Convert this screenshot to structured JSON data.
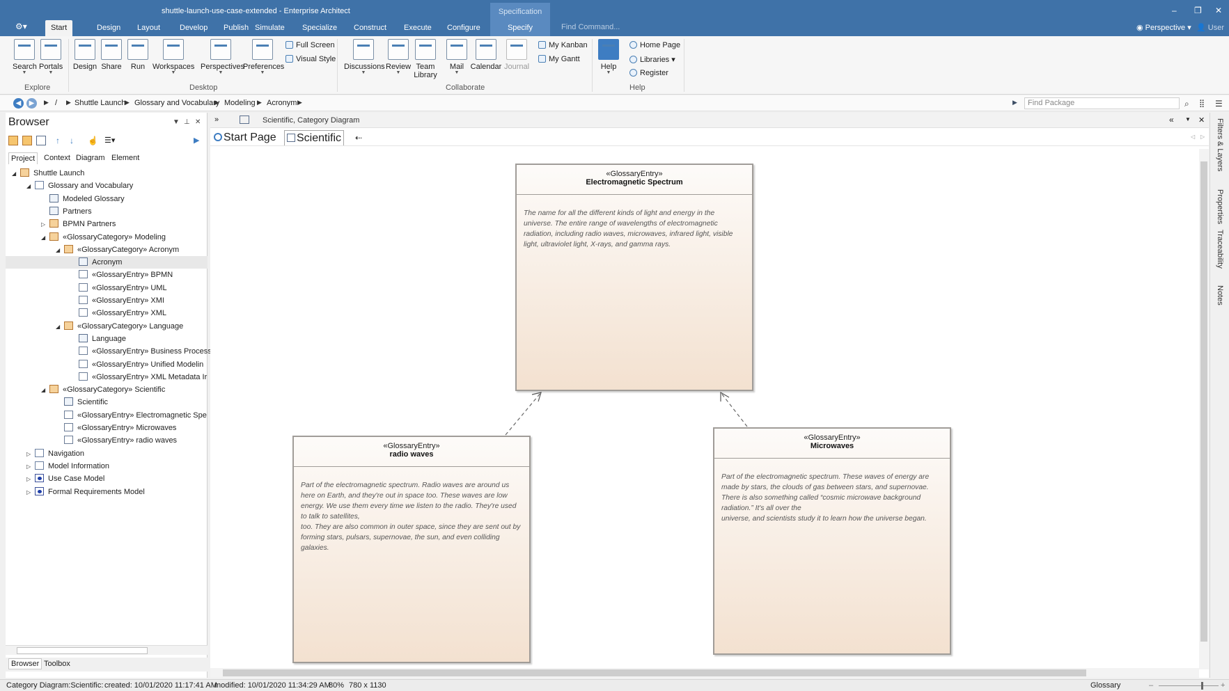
{
  "window": {
    "title": "shuttle-launch-use-case-extended - Enterprise Architect",
    "minimize": "–",
    "restore": "❐",
    "close": "✕"
  },
  "menu_tabs": [
    "Start",
    "Design",
    "Layout",
    "Develop",
    "Publish",
    "Simulate",
    "Specialize",
    "Construct",
    "Execute",
    "Configure"
  ],
  "spec_group": {
    "label": "Specification",
    "tab": "Specify"
  },
  "find_command": {
    "placeholder": "Find Command..."
  },
  "perspective": "Perspective",
  "user": "User",
  "ribbon": {
    "explore": {
      "label": "Explore",
      "search": "Search",
      "portals": "Portals"
    },
    "desktop": {
      "label": "Desktop",
      "design": "Design",
      "share": "Share",
      "run": "Run",
      "workspaces": "Workspaces",
      "perspectives": "Perspectives",
      "preferences": "Preferences",
      "full_screen": "Full Screen",
      "visual_style": "Visual Style"
    },
    "collaborate": {
      "label": "Collaborate",
      "discussions": "Discussions",
      "review": "Review",
      "team_library_1": "Team",
      "team_library_2": "Library",
      "mail": "Mail",
      "calendar": "Calendar",
      "journal": "Journal",
      "my_kanban": "My Kanban",
      "my_gantt": "My Gantt"
    },
    "help": {
      "label": "Help",
      "help": "Help",
      "home_page": "Home Page",
      "libraries": "Libraries",
      "register": "Register"
    }
  },
  "breadcrumb": [
    "/",
    "Shuttle Launch",
    "Glossary and Vocabulary",
    "Modeling",
    "Acronym"
  ],
  "find_package": {
    "placeholder": "Find Package"
  },
  "browser": {
    "title": "Browser",
    "tabs": [
      "Project",
      "Context",
      "Diagram",
      "Element"
    ],
    "tree": [
      {
        "label": "Shuttle Launch",
        "depth": 0,
        "icon": "model",
        "tw": "◢"
      },
      {
        "label": "Glossary and Vocabulary",
        "depth": 1,
        "icon": "package-model",
        "tw": "◢"
      },
      {
        "label": "Modeled Glossary",
        "depth": 2,
        "icon": "diagram",
        "tw": ""
      },
      {
        "label": "Partners",
        "depth": 2,
        "icon": "diagram",
        "tw": ""
      },
      {
        "label": "BPMN Partners",
        "depth": 2,
        "icon": "package",
        "tw": "▷"
      },
      {
        "label": "«GlossaryCategory» Modeling",
        "depth": 2,
        "icon": "package",
        "tw": "◢"
      },
      {
        "label": "«GlossaryCategory» Acronym",
        "depth": 3,
        "icon": "package",
        "tw": "◢"
      },
      {
        "label": "Acronym",
        "depth": 4,
        "icon": "diagram",
        "tw": "",
        "selected": true
      },
      {
        "label": "«GlossaryEntry» BPMN",
        "depth": 4,
        "icon": "entry",
        "tw": ""
      },
      {
        "label": "«GlossaryEntry» UML",
        "depth": 4,
        "icon": "entry",
        "tw": ""
      },
      {
        "label": "«GlossaryEntry» XMI",
        "depth": 4,
        "icon": "entry",
        "tw": ""
      },
      {
        "label": "«GlossaryEntry» XML",
        "depth": 4,
        "icon": "entry",
        "tw": ""
      },
      {
        "label": "«GlossaryCategory» Language",
        "depth": 3,
        "icon": "package",
        "tw": "◢"
      },
      {
        "label": "Language",
        "depth": 4,
        "icon": "diagram",
        "tw": ""
      },
      {
        "label": "«GlossaryEntry» Business Process",
        "depth": 4,
        "icon": "entry",
        "tw": ""
      },
      {
        "label": "«GlossaryEntry» Unified Modelin",
        "depth": 4,
        "icon": "entry",
        "tw": ""
      },
      {
        "label": "«GlossaryEntry» XML Metadata Ir",
        "depth": 4,
        "icon": "entry",
        "tw": ""
      },
      {
        "label": "«GlossaryCategory» Scientific",
        "depth": 2,
        "icon": "package",
        "tw": "◢"
      },
      {
        "label": "Scientific",
        "depth": 3,
        "icon": "diagram",
        "tw": ""
      },
      {
        "label": "«GlossaryEntry» Electromagnetic Spe",
        "depth": 3,
        "icon": "entry",
        "tw": ""
      },
      {
        "label": "«GlossaryEntry» Microwaves",
        "depth": 3,
        "icon": "entry",
        "tw": ""
      },
      {
        "label": "«GlossaryEntry» radio waves",
        "depth": 3,
        "icon": "entry",
        "tw": ""
      },
      {
        "label": "Navigation",
        "depth": 1,
        "icon": "package-model",
        "tw": "▷"
      },
      {
        "label": "Model Information",
        "depth": 1,
        "icon": "package-model",
        "tw": "▷"
      },
      {
        "label": "Use Case Model",
        "depth": 1,
        "icon": "usecase",
        "tw": "▷"
      },
      {
        "label": "Formal Requirements Model",
        "depth": 1,
        "icon": "usecase",
        "tw": "▷"
      }
    ],
    "footer_tabs": [
      "Browser",
      "Toolbox"
    ]
  },
  "diagram": {
    "caption": "Scientific,  Category Diagram",
    "tabs": [
      "Start Page",
      "Scientific"
    ],
    "elements": {
      "em": {
        "stereotype": "«GlossaryEntry»",
        "name": "Electromagnetic Spectrum",
        "lines": [
          "The name for all the different kinds of light and energy in the",
          "universe. The entire range of wavelengths of electromagnetic",
          "radiation, including radio waves, microwaves, infrared light, visible",
          "light, ultraviolet light, X-rays, and gamma rays."
        ]
      },
      "radio": {
        "stereotype": "«GlossaryEntry»",
        "name": "radio waves",
        "lines": [
          "Part of the electromagnetic spectrum. Radio waves are around us",
          "here on Earth, and they're out in space too. These waves are low",
          "energy. We use them every time we listen to the radio. They're used",
          "to talk to satellites,",
          "too. They are also common in outer space, since they are sent out by",
          "forming stars, pulsars, supernovae, the sun, and even colliding",
          "galaxies."
        ]
      },
      "micro": {
        "stereotype": "«GlossaryEntry»",
        "name": "Microwaves",
        "lines": [
          "Part of the electromagnetic spectrum. These waves of energy are",
          "made by stars, the clouds of gas between stars, and supernovae.",
          "There is also something called “cosmic microwave background",
          "radiation.” It's all over the",
          "universe, and scientists study it to learn how the universe began."
        ]
      }
    }
  },
  "right_panel": [
    "Filters & Layers",
    "Properties",
    "Traceability",
    "Notes"
  ],
  "status": {
    "diagram": "Category Diagram:Scientific:",
    "created": "created: 10/01/2020 11:17:41 AM",
    "modified": "modified: 10/01/2020 11:34:29 AM",
    "zoom": "80%",
    "size": "780 x 1130",
    "mode": "Glossary"
  }
}
